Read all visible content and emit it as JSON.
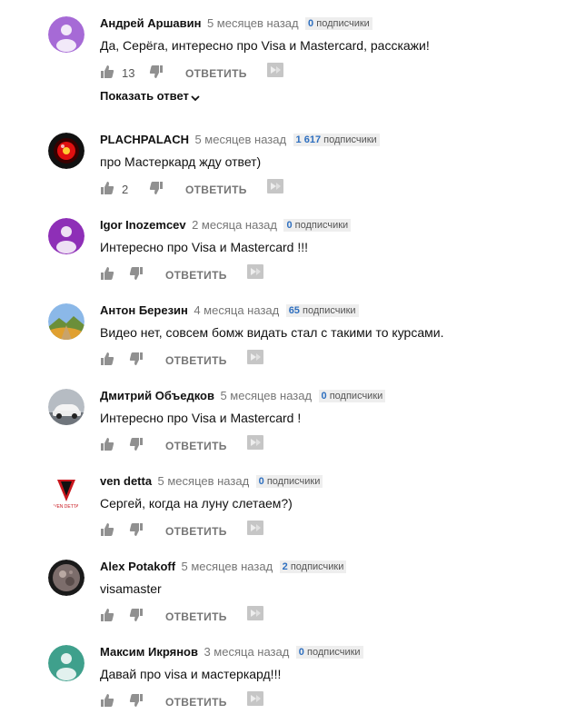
{
  "reply_label": "ОТВЕТИТЬ",
  "subs_label": "подписчики",
  "comments": [
    {
      "author": "Андрей Аршавин",
      "time": "5 месяцев назад",
      "subs": "0",
      "text": "Да, Серёга, интересно про Visa и Mastercard, расскажи!",
      "likes": "13",
      "show_replies": "Показать ответ",
      "avatar": "default-avatar",
      "avatar_color": "#a66ad6"
    },
    {
      "author": "PLACHPALACH",
      "time": "5 месяцев назад",
      "subs": "1 617",
      "text": "про Мастеркард жду ответ)",
      "likes": "2",
      "avatar": "red-eye-avatar",
      "avatar_color": "#e01010"
    },
    {
      "author": "Igor Inozemcev",
      "time": "2 месяца назад",
      "subs": "0",
      "text": "Интересно про Visa и Mastercard  !!!",
      "likes": "",
      "avatar": "default-avatar",
      "avatar_color": "#8e2fb7"
    },
    {
      "author": "Антон Березин",
      "time": "4 месяца назад",
      "subs": "65",
      "text": "Видео нет, совсем бомж видать стал с такими то курсами.",
      "likes": "",
      "avatar": "landscape-avatar",
      "avatar_color": "#4a7bbf"
    },
    {
      "author": "Дмитрий Объедков",
      "time": "5 месяцев назад",
      "subs": "0",
      "text": "Интересно про  Visa и Mastercard !",
      "likes": "",
      "avatar": "car-avatar",
      "avatar_color": "#8a8f96"
    },
    {
      "author": "ven detta",
      "time": "5 месяцев назад",
      "subs": "0",
      "text": "Сергей, когда на луну слетаем?)",
      "likes": "",
      "avatar": "vendetta-avatar",
      "avatar_color": "#c8161d"
    },
    {
      "author": "Alex Potakoff",
      "time": "5 месяцев назад",
      "subs": "2",
      "text": "visamaster",
      "likes": "",
      "avatar": "planet-avatar",
      "avatar_color": "#7c6d6b"
    },
    {
      "author": "Максим Икрянов",
      "time": "3 месяца назад",
      "subs": "0",
      "text": "Давай про visa  и мастеркард!!!",
      "likes": "",
      "avatar": "default-avatar",
      "avatar_color": "#3fa08c"
    }
  ]
}
